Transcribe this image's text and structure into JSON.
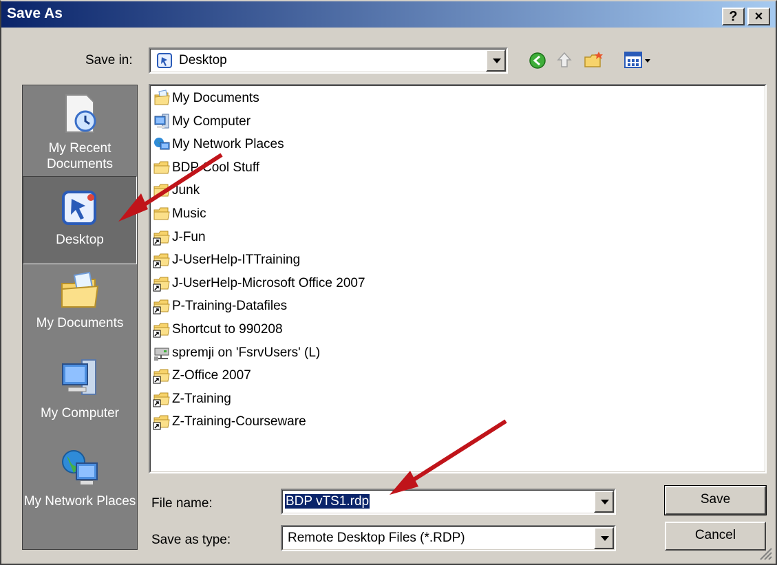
{
  "window": {
    "title": "Save As",
    "help_label": "?",
    "close_label": "×"
  },
  "save_in": {
    "label": "Save in:",
    "value": "Desktop"
  },
  "places": [
    {
      "label": "My Recent Documents",
      "icon": "recent-documents-icon"
    },
    {
      "label": "Desktop",
      "icon": "desktop-icon",
      "selected": true
    },
    {
      "label": "My Documents",
      "icon": "my-documents-icon"
    },
    {
      "label": "My Computer",
      "icon": "my-computer-icon"
    },
    {
      "label": "My Network Places",
      "icon": "network-places-icon"
    }
  ],
  "files": [
    {
      "name": "My Documents",
      "icon": "my-documents-icon"
    },
    {
      "name": "My Computer",
      "icon": "my-computer-icon"
    },
    {
      "name": "My Network Places",
      "icon": "network-places-icon"
    },
    {
      "name": "BDP Cool Stuff",
      "icon": "folder-icon"
    },
    {
      "name": "Junk",
      "icon": "folder-icon"
    },
    {
      "name": "Music",
      "icon": "folder-icon"
    },
    {
      "name": "J-Fun",
      "icon": "folder-shortcut-icon"
    },
    {
      "name": "J-UserHelp-ITTraining",
      "icon": "folder-shortcut-icon"
    },
    {
      "name": "J-UserHelp-Microsoft Office 2007",
      "icon": "folder-shortcut-icon"
    },
    {
      "name": "P-Training-Datafiles",
      "icon": "folder-shortcut-icon"
    },
    {
      "name": "Shortcut to 990208",
      "icon": "folder-shortcut-icon"
    },
    {
      "name": "spremji on 'FsrvUsers' (L)",
      "icon": "network-drive-icon"
    },
    {
      "name": "Z-Office 2007",
      "icon": "folder-shortcut-icon"
    },
    {
      "name": "Z-Training",
      "icon": "folder-shortcut-icon"
    },
    {
      "name": "Z-Training-Courseware",
      "icon": "folder-shortcut-icon"
    }
  ],
  "filename": {
    "label": "File name:",
    "value": "BDP vTS1.rdp"
  },
  "filetype": {
    "label": "Save as type:",
    "value": "Remote Desktop Files (*.RDP)"
  },
  "buttons": {
    "save": "Save",
    "cancel": "Cancel"
  }
}
